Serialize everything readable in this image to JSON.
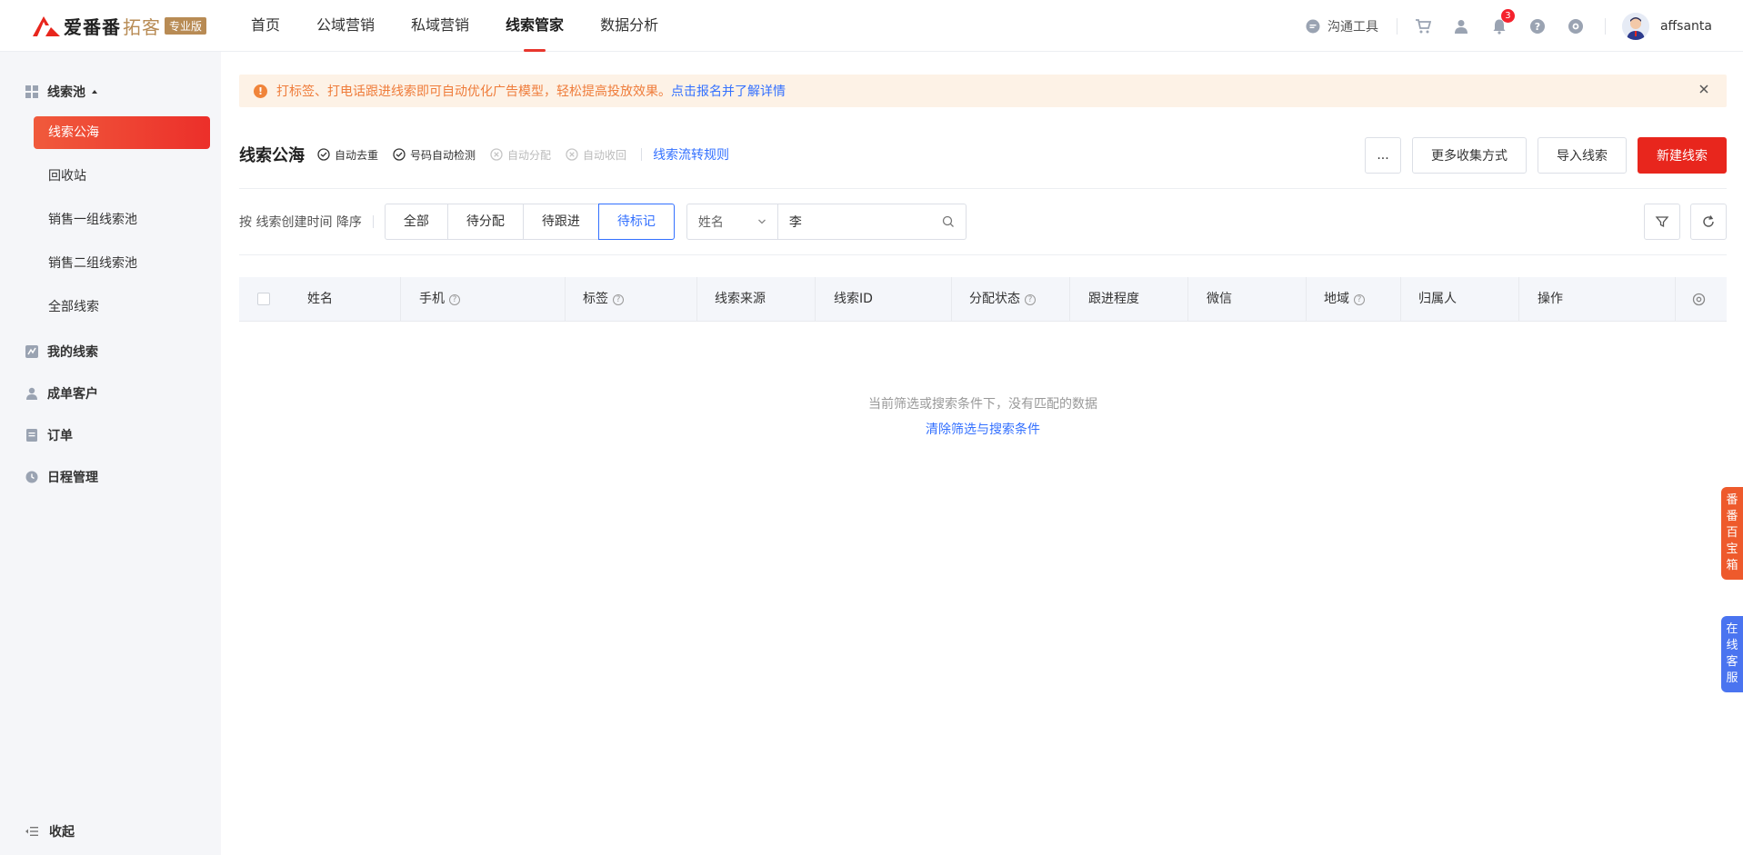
{
  "header": {
    "logo_text": "爱番番",
    "logo_sub": "拓客",
    "logo_badge": "专业版",
    "nav": [
      "首页",
      "公域营销",
      "私域营销",
      "线索管家",
      "数据分析"
    ],
    "active_nav": "线索管家",
    "tool_label": "沟通工具",
    "notification_count": "3",
    "username": "affsanta",
    "accent_color": "#e8362d"
  },
  "sidebar": {
    "group_pool": "线索池",
    "sub_items": [
      "线索公海",
      "回收站",
      "销售一组线索池",
      "销售二组线索池",
      "全部线索"
    ],
    "my_leads": "我的线索",
    "customers": "成单客户",
    "orders": "订单",
    "schedule": "日程管理",
    "collapse": "收起"
  },
  "banner": {
    "text": "打标签、打电话跟进线索即可自动优化广告模型，轻松提高投放效果。",
    "link": "点击报名并了解详情"
  },
  "toolbar": {
    "title": "线索公海",
    "flags": [
      "自动去重",
      "号码自动检测",
      "自动分配",
      "自动收回"
    ],
    "rule_link": "线索流转规则",
    "more_label": "...",
    "collect_label": "更多收集方式",
    "import_label": "导入线索",
    "new_label": "新建线索"
  },
  "filter": {
    "sort_text": "按 线索创建时间 降序",
    "tabs": [
      "全部",
      "待分配",
      "待跟进",
      "待标记"
    ],
    "active_tab": "待标记",
    "search_field": "姓名",
    "search_value": "李"
  },
  "table": {
    "columns": [
      "姓名",
      "手机",
      "标签",
      "线索来源",
      "线索ID",
      "分配状态",
      "跟进程度",
      "微信",
      "地域",
      "归属人",
      "操作"
    ],
    "empty_text": "当前筛选或搜索条件下，没有匹配的数据",
    "empty_link": "清除筛选与搜索条件"
  },
  "floating": {
    "treasure": [
      "番",
      "番",
      "百",
      "宝",
      "箱"
    ],
    "service": [
      "在",
      "线",
      "客",
      "服"
    ]
  }
}
